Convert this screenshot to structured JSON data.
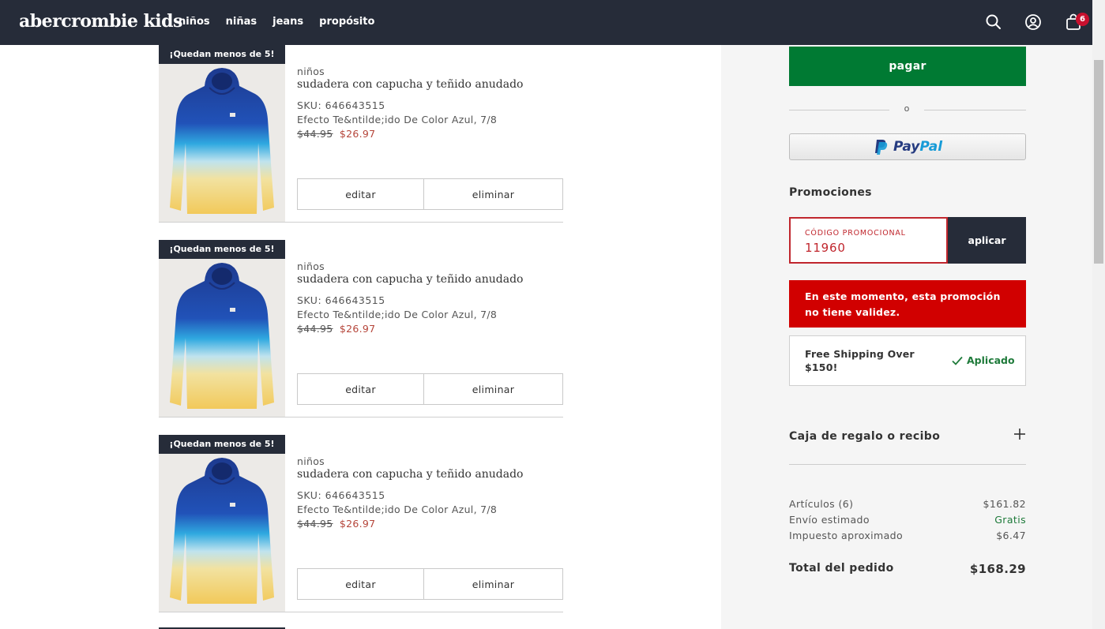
{
  "header": {
    "logo": "abercrombie kids",
    "nav": [
      "niños",
      "niñas",
      "jeans",
      "propósito"
    ],
    "bag_count": "6"
  },
  "cart_items": [
    {
      "stock_tag": "¡Quedan menos de 5!",
      "category": "niños",
      "name": "sudadera con capucha y teñido anudado",
      "sku": "SKU: 646643515",
      "variant": "Efecto Te&ntilde;ido De Color Azul, 7/8",
      "old_price": "$44.95",
      "new_price": "$26.97",
      "edit_label": "editar",
      "remove_label": "eliminar"
    },
    {
      "stock_tag": "¡Quedan menos de 5!",
      "category": "niños",
      "name": "sudadera con capucha y teñido anudado",
      "sku": "SKU: 646643515",
      "variant": "Efecto Te&ntilde;ido De Color Azul, 7/8",
      "old_price": "$44.95",
      "new_price": "$26.97",
      "edit_label": "editar",
      "remove_label": "eliminar"
    },
    {
      "stock_tag": "¡Quedan menos de 5!",
      "category": "niños",
      "name": "sudadera con capucha y teñido anudado",
      "sku": "SKU: 646643515",
      "variant": "Efecto Te&ntilde;ido De Color Azul, 7/8",
      "old_price": "$44.95",
      "new_price": "$26.97",
      "edit_label": "editar",
      "remove_label": "eliminar"
    }
  ],
  "checkout": {
    "pay_label": "pagar",
    "or_label": "o",
    "paypal_label": "PayPal",
    "promotions_title": "Promociones",
    "promo_field_label": "CÓDIGO PROMOCIONAL",
    "promo_value": "11960",
    "apply_label": "aplicar",
    "error_message": "En este momento, esta promoción no tiene validez.",
    "shipping_promo": "Free Shipping Over $150!",
    "applied_label": "Aplicado",
    "gift_label": "Caja de regalo o recibo"
  },
  "summary": {
    "items_label": "Artículos (6)",
    "items_value": "$161.82",
    "shipping_label": "Envío estimado",
    "shipping_value": "Gratis",
    "tax_label": "Impuesto aproximado",
    "tax_value": "$6.47",
    "total_label": "Total del pedido",
    "total_value": "$168.29"
  },
  "colors": {
    "header_bg": "#262c39",
    "pay_green": "#007a33",
    "error_red": "#d10000",
    "promo_red": "#c0262d",
    "sale_price": "#b5453a",
    "applied_green": "#1e7a3a"
  },
  "icons": [
    "search-icon",
    "account-icon",
    "shopping-bag-icon",
    "check-icon",
    "plus-icon",
    "paypal-logo"
  ]
}
